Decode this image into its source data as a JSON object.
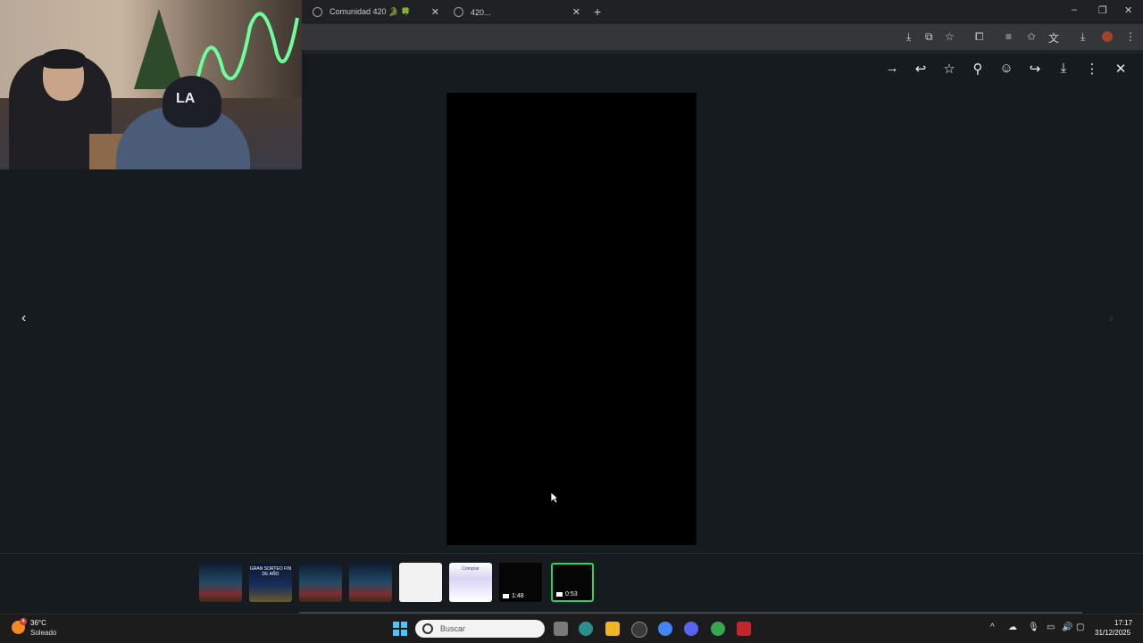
{
  "browser": {
    "tabs": [
      {
        "title": "Comunidad 420 🐊 🍀"
      },
      {
        "title": "420..."
      }
    ],
    "new_tab": "+",
    "window_controls": {
      "minimize": "–",
      "maximize": "❐",
      "close": "✕"
    }
  },
  "viewer": {
    "toolbar": [
      "arrow-right-icon",
      "reply-icon",
      "star-icon",
      "pin-icon",
      "emoji-icon",
      "forward-icon",
      "download-icon",
      "more-icon",
      "close-icon"
    ],
    "nav": {
      "prev": "‹",
      "next": "›"
    }
  },
  "thumbnails": [
    {
      "kind": "poster"
    },
    {
      "kind": "poster2",
      "label": "GRAN SORTEO FIN DE AÑO"
    },
    {
      "kind": "poster"
    },
    {
      "kind": "poster"
    },
    {
      "kind": "doc"
    },
    {
      "kind": "doc2",
      "label": "Comprar"
    },
    {
      "kind": "video",
      "duration": "1:48"
    },
    {
      "kind": "video",
      "duration": "0:53",
      "selected": true
    }
  ],
  "taskbar": {
    "weather_temp": "36°C",
    "weather_condition": "Soleado",
    "weather_badge": "4",
    "search_placeholder": "Buscar",
    "time": "17:17",
    "date": "31/12/2025"
  },
  "colors": {
    "accent": "#25d366",
    "viewer_bg": "#151b1f",
    "taskbar_bg": "#1c1c1c"
  }
}
